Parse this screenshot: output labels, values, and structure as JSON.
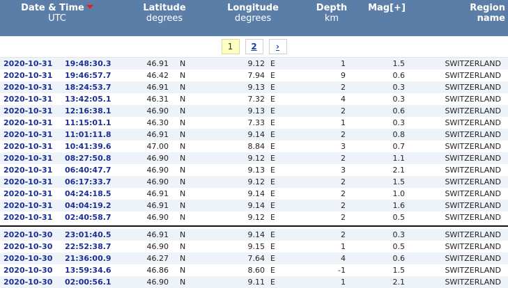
{
  "header": {
    "date_label": "Date & Time",
    "date_sub": "UTC",
    "lat_label": "Latitude",
    "lat_sub": "degrees",
    "lon_label": "Longitude",
    "lon_sub": "degrees",
    "depth_label": "Depth",
    "depth_sub": "km",
    "mag_label": "Mag[+]",
    "region_label": "Region name",
    "sort_icon": "sort-down-triangle-icon"
  },
  "pager": {
    "page1": "1",
    "page2": "2",
    "next": "›"
  },
  "groups": [
    {
      "rows": [
        {
          "date": "2020-10-31",
          "time": "19:48:30.3",
          "lat": "46.91",
          "ns": "N",
          "lon": "9.12",
          "ew": "E",
          "depth": "1",
          "mag": "1.5",
          "region": "SWITZERLAND"
        },
        {
          "date": "2020-10-31",
          "time": "19:46:57.7",
          "lat": "46.42",
          "ns": "N",
          "lon": "7.94",
          "ew": "E",
          "depth": "9",
          "mag": "0.6",
          "region": "SWITZERLAND"
        },
        {
          "date": "2020-10-31",
          "time": "18:24:53.7",
          "lat": "46.91",
          "ns": "N",
          "lon": "9.13",
          "ew": "E",
          "depth": "2",
          "mag": "0.3",
          "region": "SWITZERLAND"
        },
        {
          "date": "2020-10-31",
          "time": "13:42:05.1",
          "lat": "46.31",
          "ns": "N",
          "lon": "7.32",
          "ew": "E",
          "depth": "4",
          "mag": "0.3",
          "region": "SWITZERLAND"
        },
        {
          "date": "2020-10-31",
          "time": "12:16:38.1",
          "lat": "46.90",
          "ns": "N",
          "lon": "9.13",
          "ew": "E",
          "depth": "2",
          "mag": "0.6",
          "region": "SWITZERLAND"
        },
        {
          "date": "2020-10-31",
          "time": "11:15:01.1",
          "lat": "46.30",
          "ns": "N",
          "lon": "7.33",
          "ew": "E",
          "depth": "1",
          "mag": "0.3",
          "region": "SWITZERLAND"
        },
        {
          "date": "2020-10-31",
          "time": "11:01:11.8",
          "lat": "46.91",
          "ns": "N",
          "lon": "9.14",
          "ew": "E",
          "depth": "2",
          "mag": "0.8",
          "region": "SWITZERLAND"
        },
        {
          "date": "2020-10-31",
          "time": "10:41:39.6",
          "lat": "47.00",
          "ns": "N",
          "lon": "8.84",
          "ew": "E",
          "depth": "3",
          "mag": "0.7",
          "region": "SWITZERLAND"
        },
        {
          "date": "2020-10-31",
          "time": "08:27:50.8",
          "lat": "46.90",
          "ns": "N",
          "lon": "9.12",
          "ew": "E",
          "depth": "2",
          "mag": "1.1",
          "region": "SWITZERLAND"
        },
        {
          "date": "2020-10-31",
          "time": "06:40:47.7",
          "lat": "46.90",
          "ns": "N",
          "lon": "9.13",
          "ew": "E",
          "depth": "3",
          "mag": "2.1",
          "region": "SWITZERLAND"
        },
        {
          "date": "2020-10-31",
          "time": "06:17:33.7",
          "lat": "46.90",
          "ns": "N",
          "lon": "9.12",
          "ew": "E",
          "depth": "2",
          "mag": "1.5",
          "region": "SWITZERLAND"
        },
        {
          "date": "2020-10-31",
          "time": "04:24:18.5",
          "lat": "46.91",
          "ns": "N",
          "lon": "9.14",
          "ew": "E",
          "depth": "2",
          "mag": "1.0",
          "region": "SWITZERLAND"
        },
        {
          "date": "2020-10-31",
          "time": "04:04:19.2",
          "lat": "46.91",
          "ns": "N",
          "lon": "9.14",
          "ew": "E",
          "depth": "2",
          "mag": "1.6",
          "region": "SWITZERLAND"
        },
        {
          "date": "2020-10-31",
          "time": "02:40:58.7",
          "lat": "46.90",
          "ns": "N",
          "lon": "9.12",
          "ew": "E",
          "depth": "2",
          "mag": "0.5",
          "region": "SWITZERLAND"
        }
      ]
    },
    {
      "rows": [
        {
          "date": "2020-10-30",
          "time": "23:01:40.5",
          "lat": "46.91",
          "ns": "N",
          "lon": "9.14",
          "ew": "E",
          "depth": "2",
          "mag": "0.3",
          "region": "SWITZERLAND"
        },
        {
          "date": "2020-10-30",
          "time": "22:52:38.7",
          "lat": "46.90",
          "ns": "N",
          "lon": "9.15",
          "ew": "E",
          "depth": "1",
          "mag": "0.5",
          "region": "SWITZERLAND"
        },
        {
          "date": "2020-10-30",
          "time": "21:36:00.9",
          "lat": "46.27",
          "ns": "N",
          "lon": "7.64",
          "ew": "E",
          "depth": "4",
          "mag": "0.6",
          "region": "SWITZERLAND"
        },
        {
          "date": "2020-10-30",
          "time": "13:59:34.6",
          "lat": "46.86",
          "ns": "N",
          "lon": "8.60",
          "ew": "E",
          "depth": "-1",
          "mag": "1.5",
          "region": "SWITZERLAND"
        },
        {
          "date": "2020-10-30",
          "time": "02:00:56.1",
          "lat": "46.90",
          "ns": "N",
          "lon": "9.11",
          "ew": "E",
          "depth": "1",
          "mag": "2.1",
          "region": "SWITZERLAND"
        }
      ]
    }
  ]
}
